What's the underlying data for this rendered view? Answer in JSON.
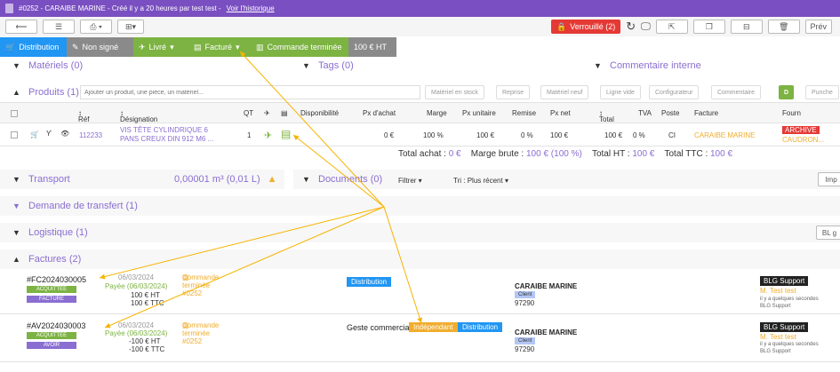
{
  "topbar": {
    "text": "#0252  -  CARAIBE MARINE  -  Créé il y a 20 heures par test test  - ",
    "link": "Voir l'historique"
  },
  "toolbar": {
    "lock_label": "Verrouillé (2)",
    "preview_label": "Prév"
  },
  "status": {
    "distribution": "Distribution",
    "non_signe": "Non signé",
    "livre": "Livré",
    "facture": "Facturé",
    "commande": "Commande terminée",
    "amount": "100 € HT",
    "colors": {
      "distribution": "#2196f3",
      "grey": "#8a8a8a",
      "green": "#7cb342"
    }
  },
  "sections": {
    "materiels": "Matériels (0)",
    "tags": "Tags (0)",
    "commentaire": "Commentaire interne",
    "produits": "Produits (1)",
    "transport": "Transport",
    "transport_volume": "0,00001 m³ (0,01 L)",
    "documents": "Documents (0)",
    "filtrer": "Filtrer",
    "tri": "Tri : Plus récent",
    "imp": "Imp",
    "transfert": "Demande de transfert (1)",
    "logistique": "Logistique (1)",
    "bl": "BL g",
    "factures": "Factures (2)"
  },
  "produits": {
    "placeholder": "Ajouter un produit, une pièce, un matériel...",
    "chips": [
      "Matériel en stock",
      "Reprise",
      "Matériel neuf",
      "Ligne vide",
      "Configurateur",
      "Commentaire",
      "D",
      "Punche"
    ]
  },
  "columns": [
    "Réf",
    "Désignation",
    "QT",
    "Disponibilité",
    "Px d'achat",
    "Marge",
    "Px unitaire",
    "Remise",
    "Px net",
    "Total",
    "TVA",
    "Poste",
    "Facture",
    "Fourn"
  ],
  "product": {
    "ref": "112233",
    "designation1": "VIS TÊTE CYLINDRIQUE 6",
    "designation2": "PANS CREUX DIN 912 M6 ...",
    "qt": "1",
    "px_achat": "0 €",
    "marge": "100 %",
    "px_unit": "100 €",
    "remise": "0 %",
    "px_net": "100 €",
    "total": "100 €",
    "tva": "0 %",
    "poste": "CI",
    "facture": "CARAIBE MARINE",
    "fourn_badge": "ARCHIVE",
    "fourn": "CAUDRON..."
  },
  "totals": {
    "achat_label": "Total achat :",
    "achat": "0 €",
    "marge_label": "Marge brute :",
    "marge": "100 € (100 %)",
    "ht_label": "Total HT :",
    "ht": "100 €",
    "ttc_label": "Total TTC :",
    "ttc": "100 €"
  },
  "invoices": [
    {
      "num": "#FC2024030005",
      "b1": "ACQUITTÉE",
      "b2": "FACTURE",
      "date": "06/03/2024",
      "paid": "Payée (06/03/2024)",
      "ht": "100 €  HT",
      "ttc": "100 €  TTC",
      "cmd": "Commande terminée #0252",
      "tag": "Distribution",
      "client": "CARAIBE MARINE",
      "client_badge": "Client",
      "cp": "97290",
      "support": "BLG Support",
      "user": "M. Test test",
      "ago": "il y a quelques secondes",
      "by": "BLG Support"
    },
    {
      "num": "#AV2024030003",
      "b1": "ACQUITTÉE",
      "b2": "AVOIR",
      "date": "06/03/2024",
      "paid": "Payée (06/03/2024)",
      "ht": "-100 €  HT",
      "ttc": "-100 €  TTC",
      "cmd": "Commande terminée #0252",
      "geste": "Geste commercial",
      "tag_ind": "Indépendant",
      "tag": "Distribution",
      "client": "CARAIBE MARINE",
      "client_badge": "Client",
      "cp": "97290",
      "support": "BLG Support",
      "user": "M. Test test",
      "ago": "il y a quelques secondes",
      "by": "BLG Support"
    }
  ]
}
